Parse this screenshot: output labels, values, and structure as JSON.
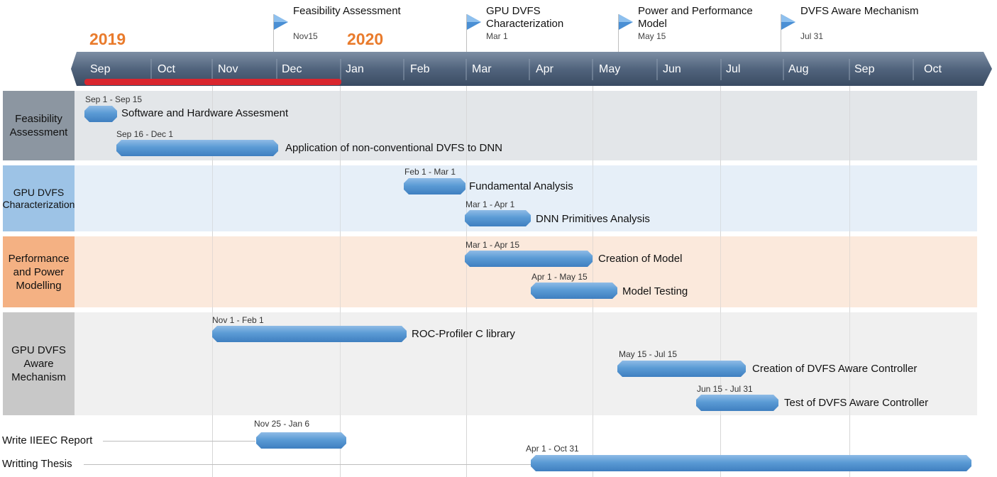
{
  "years": {
    "first": "2019",
    "second": "2020"
  },
  "months": [
    "Sep",
    "Oct",
    "Nov",
    "Dec",
    "Jan",
    "Feb",
    "Mar",
    "Apr",
    "May",
    "Jun",
    "Jul",
    "Aug",
    "Sep",
    "Oct"
  ],
  "milestones": [
    {
      "title": "Feasibility Assessment",
      "date": "Nov15"
    },
    {
      "title": "GPU DVFS Characterization",
      "date": "Mar 1"
    },
    {
      "title": "Power and Performance Model",
      "date": "May 15"
    },
    {
      "title": "DVFS Aware Mechanism",
      "date": "Jul 31"
    }
  ],
  "lanes": [
    {
      "label": "Feasibility Assessment",
      "color": "#8c96a1",
      "bg": "#e3e6e9",
      "tasks": [
        {
          "dates": "Sep 1 - Sep 15",
          "name": "Software and Hardware Assesment"
        },
        {
          "dates": "Sep 16 - Dec 1",
          "name": "Application of non-conventional DVFS to DNN"
        }
      ]
    },
    {
      "label": "GPU DVFS Characterization",
      "color": "#9dc3e6",
      "bg": "#e6eff8",
      "tasks": [
        {
          "dates": "Feb 1 - Mar 1",
          "name": "Fundamental Analysis"
        },
        {
          "dates": "Mar 1 - Apr 1",
          "name": "DNN Primitives Analysis"
        }
      ]
    },
    {
      "label": "Performance and Power Modelling",
      "color": "#f4b183",
      "bg": "#fbe9dc",
      "tasks": [
        {
          "dates": "Mar 1 - Apr 15",
          "name": "Creation of Model"
        },
        {
          "dates": "Apr 1 - May 15",
          "name": "Model Testing"
        }
      ]
    },
    {
      "label": "GPU DVFS Aware Mechanism",
      "color": "#c8c8c8",
      "bg": "#f0f0f0",
      "tasks": [
        {
          "dates": "Nov 1 - Feb 1",
          "name": "ROC-Profiler C library"
        },
        {
          "dates": "May 15 - Jul 15",
          "name": "Creation of DVFS Aware Controller"
        },
        {
          "dates": "Jun 15 - Jul 31",
          "name": "Test of DVFS Aware Controller"
        }
      ]
    }
  ],
  "free_tasks": [
    {
      "label": "Write IIEEC Report",
      "dates": "Nov 25 - Jan 6"
    },
    {
      "label": "Writting Thesis",
      "dates": "Apr 1 - Oct 31"
    }
  ]
}
